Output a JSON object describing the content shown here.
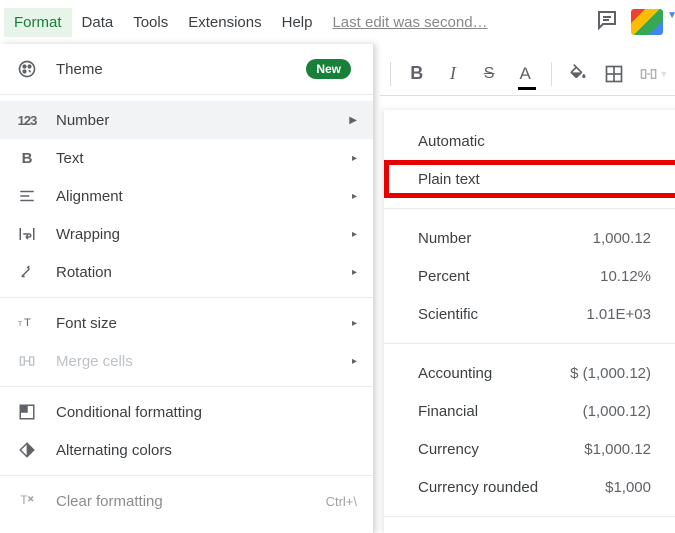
{
  "menubar": {
    "items": [
      {
        "label": "Format"
      },
      {
        "label": "Data"
      },
      {
        "label": "Tools"
      },
      {
        "label": "Extensions"
      },
      {
        "label": "Help"
      }
    ],
    "active_index": 0,
    "last_edit": "Last edit was second…"
  },
  "theme_row": {
    "label": "Theme",
    "badge": "New"
  },
  "format_menu": [
    {
      "label": "Number",
      "icon": "123"
    },
    {
      "label": "Text",
      "icon": "B"
    },
    {
      "label": "Alignment",
      "icon": "≡"
    },
    {
      "label": "Wrapping",
      "icon": "wrap"
    },
    {
      "label": "Rotation",
      "icon": "rot"
    }
  ],
  "font_row": {
    "label": "Font size"
  },
  "merge_row": {
    "label": "Merge cells"
  },
  "cond_row": {
    "label": "Conditional formatting"
  },
  "alt_row": {
    "label": "Alternating colors"
  },
  "clear_row": {
    "label": "Clear formatting",
    "shortcut": "Ctrl+\\"
  },
  "number_menu": {
    "group1": [
      {
        "label": "Automatic",
        "sample": ""
      },
      {
        "label": "Plain text",
        "sample": ""
      }
    ],
    "group2": [
      {
        "label": "Number",
        "sample": "1,000.12"
      },
      {
        "label": "Percent",
        "sample": "10.12%"
      },
      {
        "label": "Scientific",
        "sample": "1.01E+03"
      }
    ],
    "group3": [
      {
        "label": "Accounting",
        "sample": "$ (1,000.12)"
      },
      {
        "label": "Financial",
        "sample": "(1,000.12)"
      },
      {
        "label": "Currency",
        "sample": "$1,000.12"
      },
      {
        "label": "Currency rounded",
        "sample": "$1,000"
      }
    ]
  }
}
